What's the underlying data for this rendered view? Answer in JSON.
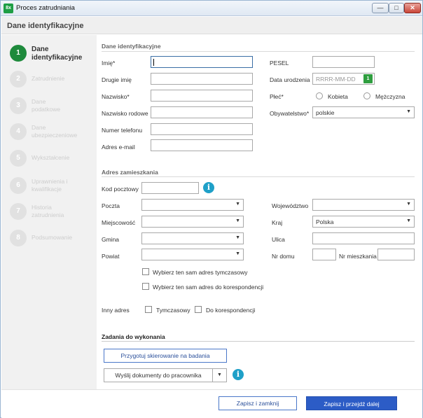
{
  "window": {
    "title": "Proces zatrudniania",
    "icon_text": "8x",
    "minimize": "—",
    "maximize": "□",
    "close": "✕"
  },
  "header": {
    "title": "Dane identyfikacyjne"
  },
  "steps": [
    {
      "num": "1",
      "label": "Dane identyfikacyjne"
    },
    {
      "num": "2",
      "label": "Zatrudnienie"
    },
    {
      "num": "3",
      "label": "Dane podatkowe"
    },
    {
      "num": "4",
      "label": "Dane ubezpieczeniowe"
    },
    {
      "num": "5",
      "label": "Wykształcenie"
    },
    {
      "num": "6",
      "label": "Uprawnienia i kwalifikacje"
    },
    {
      "num": "7",
      "label": "Historia zatrudnienia"
    },
    {
      "num": "8",
      "label": "Podsumowanie"
    }
  ],
  "identity": {
    "section_title": "Dane identyfikacyjne",
    "imie_label": "Imię*",
    "imie_value": "",
    "drugie_imie_label": "Drugie imię",
    "nazwisko_label": "Nazwisko*",
    "nazwisko_rodowe_label": "Nazwisko rodowe",
    "telefon_label": "Numer telefonu",
    "email_label": "Adres e-mail",
    "pesel_label": "PESEL",
    "data_urodzenia_label": "Data urodzenia",
    "data_urodzenia_placeholder": "RRRR-MM-DD",
    "calendar_day": "1",
    "plec_label": "Płeć*",
    "kobieta_label": "Kobieta",
    "mezczyzna_label": "Mężczyzna",
    "obywatelstwo_label": "Obywatelstwo*",
    "obywatelstwo_value": "polskie"
  },
  "address": {
    "section_title": "Adres zamieszkania",
    "kod_pocztowy_label": "Kod pocztowy",
    "info_glyph": "i",
    "poczta_label": "Poczta",
    "miejscowosc_label": "Miejscowość",
    "gmina_label": "Gmina",
    "powiat_label": "Powiat",
    "wojewodztwo_label": "Województwo",
    "kraj_label": "Kraj",
    "kraj_value": "Polska",
    "ulica_label": "Ulica",
    "nr_domu_label": "Nr domu",
    "nr_mieszkania_label": "Nr mieszkania",
    "same_temp_label": "Wybierz ten sam adres tymczasowy",
    "same_corr_label": "Wybierz ten sam adres do korespondencji",
    "inny_adres_label": "Inny adres",
    "tymczasowy_label": "Tymczasowy",
    "korespondencji_label": "Do korespondencji"
  },
  "tasks": {
    "section_title": "Zadania do wykonania",
    "prepare_button": "Przygotuj skierowanie na badania",
    "send_button": "Wyślij dokumenty do pracownika"
  },
  "footer": {
    "save_close": "Zapisz i zamknij",
    "save_next": "Zapisz i przejdź dalej"
  },
  "arrow_glyph": "▼"
}
